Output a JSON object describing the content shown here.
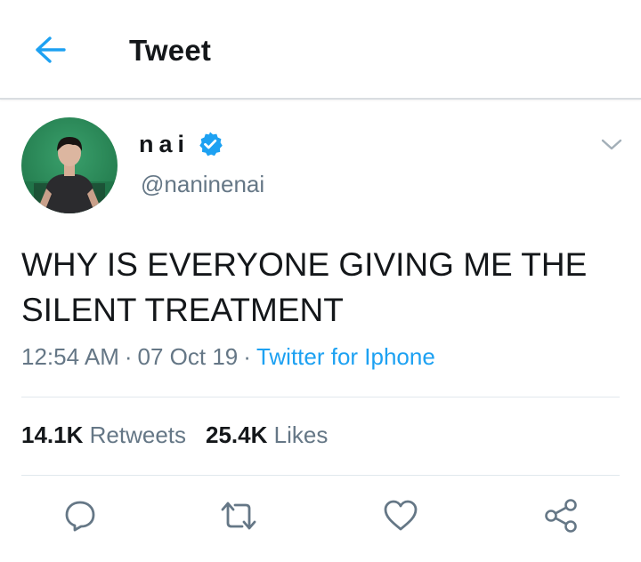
{
  "header": {
    "title": "Tweet",
    "back_icon": "arrow-left-icon"
  },
  "author": {
    "display_name": "nai",
    "handle": "@naninenai",
    "verified_icon": "verified-badge-icon"
  },
  "tweet": {
    "text": "WHY IS EVERYONE GIVING ME THE SILENT TREATMENT",
    "time": "12:54 AM",
    "date": "07 Oct 19",
    "separator": "·",
    "source": "Twitter for Iphone"
  },
  "stats": {
    "retweets_count": "14.1K",
    "retweets_label": "Retweets",
    "likes_count": "25.4K",
    "likes_label": "Likes"
  },
  "actions": [
    {
      "name": "reply",
      "icon": "reply-icon"
    },
    {
      "name": "retweet",
      "icon": "retweet-icon"
    },
    {
      "name": "like",
      "icon": "heart-icon"
    },
    {
      "name": "share",
      "icon": "share-icon"
    }
  ],
  "colors": {
    "accent": "#1da1f2",
    "text_primary": "#14171a",
    "text_secondary": "#657786",
    "divider": "#e1e8ed",
    "avatar_background": "#2a8a5a"
  }
}
